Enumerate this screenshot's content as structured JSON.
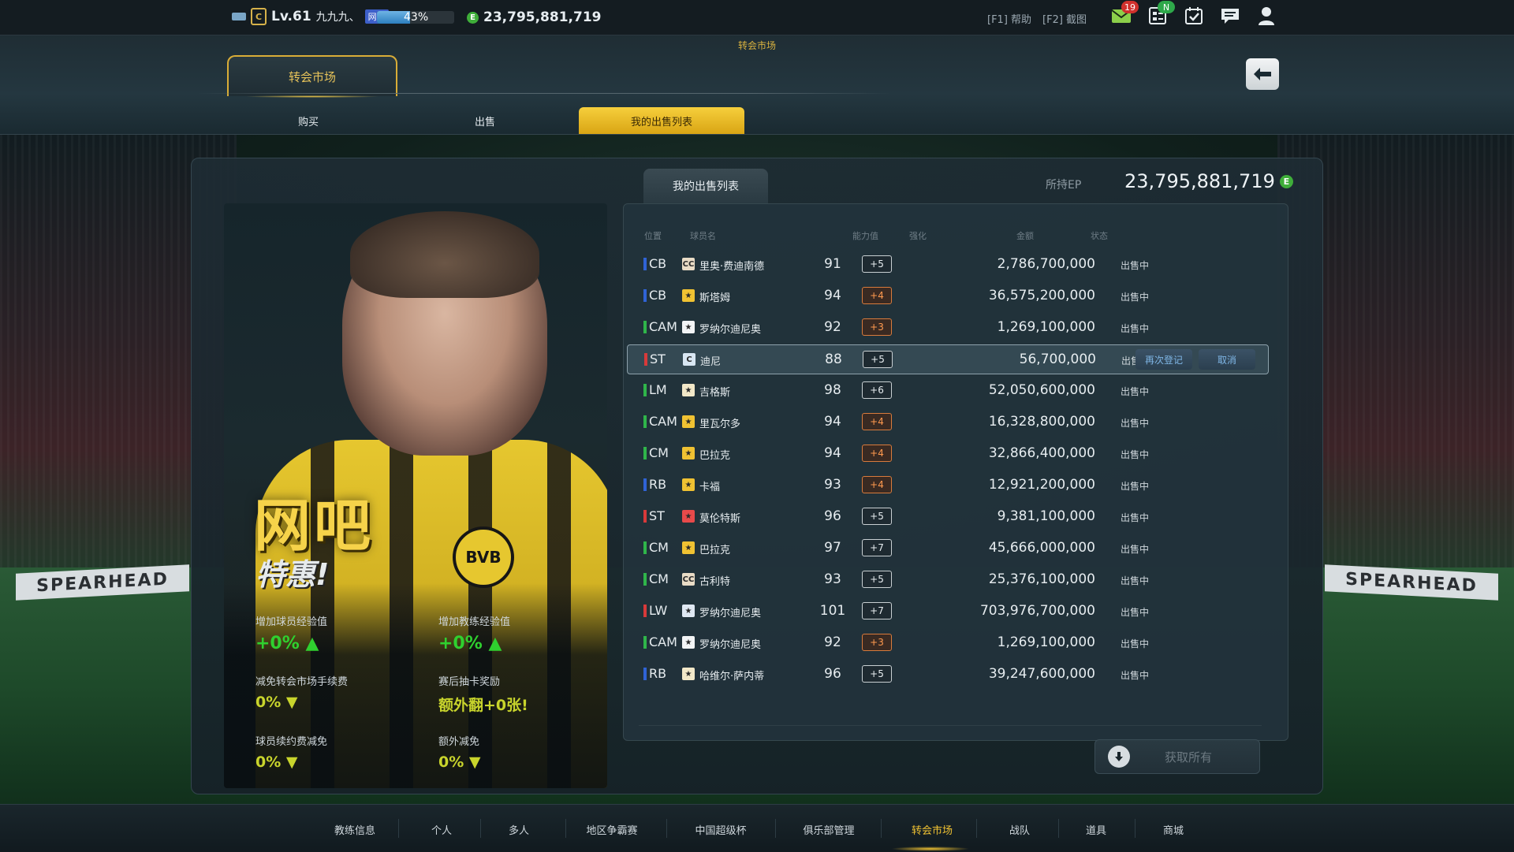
{
  "topbar": {
    "level": "Lv.61",
    "nickname": "九九九、",
    "net_tag": "网吧",
    "exp_percent": "43%",
    "exp_fraction": 0.43,
    "coins": "23,795,881,719",
    "help": "[F1] 帮助",
    "screenshot": "[F2] 截图",
    "mail_count": "19",
    "new_badge": "N"
  },
  "header": {
    "subtitle": "转会市场",
    "main_tab": "转会市场",
    "subtabs": [
      "购买",
      "出售",
      "我的出售列表"
    ],
    "active_subtab": 2
  },
  "promo": {
    "title": "网吧",
    "subtitle": "特惠!",
    "stats": [
      {
        "label": "增加球员经验值",
        "value": "+0% ▲"
      },
      {
        "label": "增加教练经验值",
        "value": "+0% ▲"
      },
      {
        "label": "减免转会市场手续费",
        "value": "0% ▼"
      },
      {
        "label": "赛后抽卡奖励",
        "value": "额外翻+0张!"
      },
      {
        "label": "球员续约费减免",
        "value": "0% ▼"
      },
      {
        "label": "额外减免",
        "value": "0% ▼"
      }
    ]
  },
  "list": {
    "tab": "我的出售列表",
    "ep_label": "所持EP",
    "ep_value": "23,795,881,719",
    "headers": {
      "pos": "位置",
      "name": "球员名",
      "ovr": "能力值",
      "enh": "强化",
      "amt": "金额",
      "status": "状态"
    },
    "rows": [
      {
        "pos": "CB",
        "posColor": "#2f63d6",
        "card": "CC",
        "cardColor": "#e9dcc6",
        "name": "里奥·费迪南德",
        "ovr": "91",
        "enh": "+5",
        "enhStyle": "w",
        "amt": "2,786,700,000",
        "status": "出售中"
      },
      {
        "pos": "CB",
        "posColor": "#2f63d6",
        "card": "★",
        "cardColor": "#f0c232",
        "name": "斯塔姆",
        "ovr": "94",
        "enh": "+4",
        "enhStyle": "o",
        "amt": "36,575,200,000",
        "status": "出售中"
      },
      {
        "pos": "CAM",
        "posColor": "#2fb54a",
        "card": "★",
        "cardColor": "#f2f4f5",
        "name": "罗纳尔迪尼奥",
        "ovr": "92",
        "enh": "+3",
        "enhStyle": "o",
        "amt": "1,269,100,000",
        "status": "出售中"
      },
      {
        "pos": "ST",
        "posColor": "#d83a3a",
        "card": "C",
        "cardColor": "#d8e6f2",
        "name": "迪尼",
        "ovr": "88",
        "enh": "+5",
        "enhStyle": "w",
        "amt": "56,700,000",
        "status": "出售中",
        "selected": true
      },
      {
        "pos": "LM",
        "posColor": "#2fb54a",
        "card": "★",
        "cardColor": "#f2e8c8",
        "name": "吉格斯",
        "ovr": "98",
        "enh": "+6",
        "enhStyle": "w",
        "amt": "52,050,600,000",
        "status": "出售中"
      },
      {
        "pos": "CAM",
        "posColor": "#2fb54a",
        "card": "★",
        "cardColor": "#f0c232",
        "name": "里瓦尔多",
        "ovr": "94",
        "enh": "+4",
        "enhStyle": "o",
        "amt": "16,328,800,000",
        "status": "出售中"
      },
      {
        "pos": "CM",
        "posColor": "#2fb54a",
        "card": "★",
        "cardColor": "#f0c232",
        "name": "巴拉克",
        "ovr": "94",
        "enh": "+4",
        "enhStyle": "o",
        "amt": "32,866,400,000",
        "status": "出售中"
      },
      {
        "pos": "RB",
        "posColor": "#2f63d6",
        "card": "★",
        "cardColor": "#f0c232",
        "name": "卡福",
        "ovr": "93",
        "enh": "+4",
        "enhStyle": "o",
        "amt": "12,921,200,000",
        "status": "出售中"
      },
      {
        "pos": "ST",
        "posColor": "#d83a3a",
        "card": "★",
        "cardColor": "#e84a4a",
        "name": "莫伦特斯",
        "ovr": "96",
        "enh": "+5",
        "enhStyle": "w",
        "amt": "9,381,100,000",
        "status": "出售中"
      },
      {
        "pos": "CM",
        "posColor": "#2fb54a",
        "card": "★",
        "cardColor": "#f0c232",
        "name": "巴拉克",
        "ovr": "97",
        "enh": "+7",
        "enhStyle": "w",
        "amt": "45,666,000,000",
        "status": "出售中"
      },
      {
        "pos": "CM",
        "posColor": "#2fb54a",
        "card": "CC",
        "cardColor": "#e9dcc6",
        "name": "古利特",
        "ovr": "93",
        "enh": "+5",
        "enhStyle": "w",
        "amt": "25,376,100,000",
        "status": "出售中"
      },
      {
        "pos": "LW",
        "posColor": "#d83a3a",
        "card": "★",
        "cardColor": "#dfe8f2",
        "name": "罗纳尔迪尼奥",
        "ovr": "101",
        "enh": "+7",
        "enhStyle": "w",
        "amt": "703,976,700,000",
        "status": "出售中"
      },
      {
        "pos": "CAM",
        "posColor": "#2fb54a",
        "card": "★",
        "cardColor": "#f2f4f5",
        "name": "罗纳尔迪尼奥",
        "ovr": "92",
        "enh": "+3",
        "enhStyle": "o",
        "amt": "1,269,100,000",
        "status": "出售中"
      },
      {
        "pos": "RB",
        "posColor": "#2f63d6",
        "card": "★",
        "cardColor": "#f2e8c8",
        "name": "哈维尔·萨内蒂",
        "ovr": "96",
        "enh": "+5",
        "enhStyle": "w",
        "amt": "39,247,600,000",
        "status": "出售中"
      }
    ],
    "relist": "再次登记",
    "cancel": "取消",
    "get_all": "获取所有"
  },
  "bottomnav": {
    "items": [
      "教练信息",
      "个人",
      "多人",
      "地区争霸赛",
      "中国超级杯",
      "俱乐部管理",
      "转会市场",
      "战队",
      "道具",
      "商城"
    ],
    "active": 6
  },
  "background": {
    "board_text": "SPEARHEAD"
  }
}
